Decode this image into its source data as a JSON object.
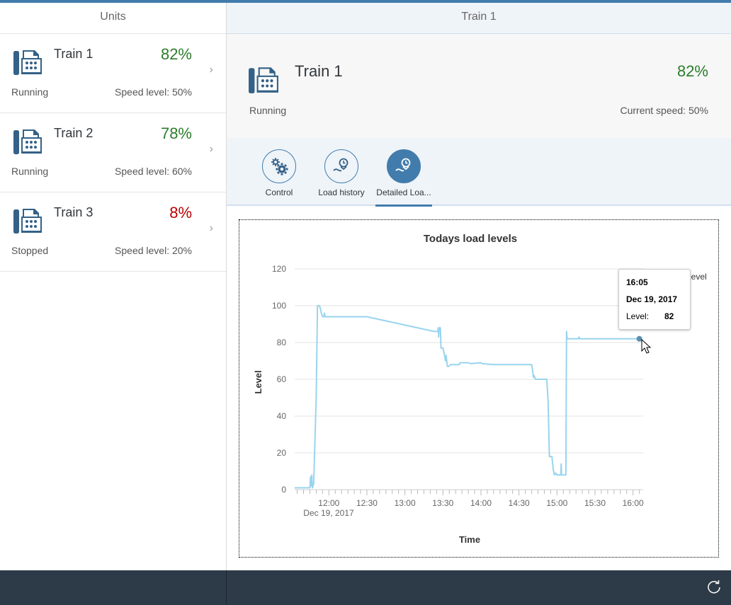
{
  "master": {
    "title": "Units",
    "items": [
      {
        "title": "Train 1",
        "number": "82%",
        "number_state": "success",
        "status": "Running",
        "attribute": "Speed level: 50%"
      },
      {
        "title": "Train 2",
        "number": "78%",
        "number_state": "success",
        "status": "Running",
        "attribute": "Speed level: 60%"
      },
      {
        "title": "Train 3",
        "number": "8%",
        "number_state": "error",
        "status": "Stopped",
        "attribute": "Speed level: 20%"
      }
    ]
  },
  "detail": {
    "title": "Train 1",
    "object": {
      "title": "Train 1",
      "number": "82%",
      "number_state": "success",
      "status": "Running",
      "attribute": "Current speed: 50%"
    },
    "tabs": [
      {
        "label": "Control",
        "icon": "gears-icon",
        "selected": false
      },
      {
        "label": "Load history",
        "icon": "load-history-icon",
        "selected": false
      },
      {
        "label": "Detailed Loa...",
        "icon": "detailed-load-icon",
        "selected": true
      }
    ]
  },
  "colors": {
    "brand": "#427cac",
    "success": "#2b7d2b",
    "error": "#bb0000",
    "series": "#99d4ee",
    "footer": "#2d3a47"
  },
  "footer": {
    "refresh_icon": "refresh-icon"
  },
  "tooltip": {
    "time": "16:05",
    "date": "Dec 19, 2017",
    "label": "Level:",
    "value": "82"
  },
  "chart_data": {
    "type": "line",
    "title": "Todays load levels",
    "xlabel": "Time",
    "ylabel": "Level",
    "x_unit": "minutes since midnight",
    "xlim": [
      693,
      968
    ],
    "ylim": [
      0,
      120
    ],
    "y_ticks": [
      0,
      20,
      40,
      60,
      80,
      100,
      120
    ],
    "x_ticks": [
      {
        "value": 720,
        "label": "12:00"
      },
      {
        "value": 750,
        "label": "12:30"
      },
      {
        "value": 780,
        "label": "13:00"
      },
      {
        "value": 810,
        "label": "13:30"
      },
      {
        "value": 840,
        "label": "14:00"
      },
      {
        "value": 870,
        "label": "14:30"
      },
      {
        "value": 900,
        "label": "15:00"
      },
      {
        "value": 930,
        "label": "15:30"
      },
      {
        "value": 960,
        "label": "16:00"
      }
    ],
    "x_date_label": "Dec 19, 2017",
    "grid": true,
    "legend": {
      "entries": [
        "Level"
      ],
      "position": "top-right"
    },
    "series": [
      {
        "name": "Level",
        "points": [
          [
            693,
            1
          ],
          [
            705,
            1
          ],
          [
            705.5,
            7
          ],
          [
            706,
            2
          ],
          [
            706.5,
            8
          ],
          [
            707,
            1
          ],
          [
            708,
            3
          ],
          [
            710,
            50
          ],
          [
            711,
            100
          ],
          [
            712.5,
            100
          ],
          [
            713.5,
            98
          ],
          [
            714,
            96
          ],
          [
            715,
            94
          ],
          [
            716,
            94
          ],
          [
            716.5,
            96
          ],
          [
            717,
            94
          ],
          [
            750,
            94
          ],
          [
            803,
            86
          ],
          [
            806,
            86
          ],
          [
            806.3,
            88
          ],
          [
            806.6,
            83
          ],
          [
            807,
            88
          ],
          [
            808,
            88
          ],
          [
            808.5,
            77
          ],
          [
            810,
            77
          ],
          [
            811,
            74
          ],
          [
            811.5,
            72
          ],
          [
            812,
            70
          ],
          [
            812.5,
            73
          ],
          [
            813,
            70
          ],
          [
            813.5,
            67
          ],
          [
            814.5,
            67
          ],
          [
            816,
            68
          ],
          [
            823,
            68
          ],
          [
            823.5,
            69
          ],
          [
            830,
            69
          ],
          [
            832,
            68.5
          ],
          [
            840,
            69
          ],
          [
            841,
            68.5
          ],
          [
            850,
            68
          ],
          [
            880,
            68
          ],
          [
            880.5,
            66
          ],
          [
            881.5,
            61
          ],
          [
            882,
            62
          ],
          [
            883,
            60
          ],
          [
            884,
            60
          ],
          [
            892,
            60
          ],
          [
            893,
            48
          ],
          [
            894,
            18
          ],
          [
            896,
            18
          ],
          [
            897,
            11
          ],
          [
            898,
            8
          ],
          [
            899,
            9
          ],
          [
            900,
            8
          ],
          [
            903,
            8
          ],
          [
            903.3,
            14
          ],
          [
            903.6,
            8
          ],
          [
            907,
            8
          ],
          [
            907.5,
            86
          ],
          [
            908,
            82
          ],
          [
            917,
            82
          ],
          [
            917.3,
            83
          ],
          [
            918,
            82
          ],
          [
            965,
            82
          ]
        ]
      }
    ],
    "highlighted_point": {
      "time": "16:05",
      "value": 82
    }
  }
}
